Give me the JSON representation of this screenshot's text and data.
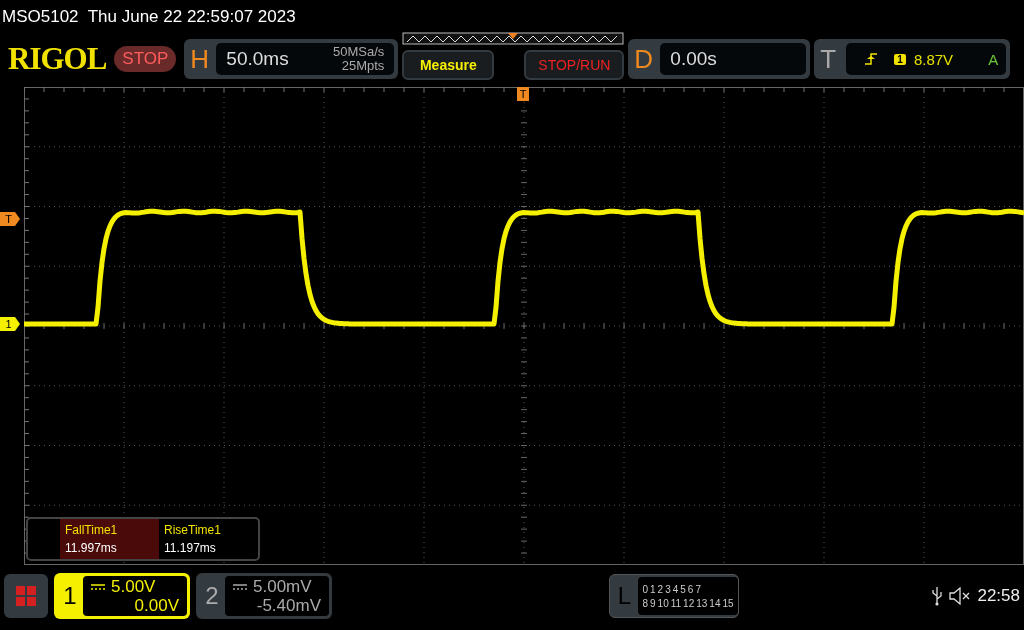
{
  "device_info": "MSO5102  Thu June 22 22:59:07 2023",
  "logo": "RIGOL",
  "run_state": {
    "label": "STOP",
    "kind": "stop"
  },
  "horizontal": {
    "letter": "H",
    "timebase": "50.0ms",
    "sample_rate": "50MSa/s",
    "memory_depth": "25Mpts"
  },
  "buttons": [
    {
      "label": "Measure",
      "kind": "measure"
    },
    {
      "label": "STOP/RUN",
      "kind": "stoprun"
    }
  ],
  "delay": {
    "letter": "D",
    "value": "0.00s"
  },
  "trigger": {
    "letter": "T",
    "source": "1",
    "level": "8.87V",
    "mode": "A"
  },
  "markers": [
    {
      "label": "T",
      "kind": "trigger-position"
    },
    {
      "label": "T",
      "kind": "trigger-level"
    },
    {
      "label": "1",
      "kind": "channel"
    }
  ],
  "measurements": [
    {
      "name": "FallTime1",
      "value": "11.997ms",
      "selected": true
    },
    {
      "name": "RiseTime1",
      "value": "11.197ms",
      "selected": false
    }
  ],
  "channels": [
    {
      "number": "1",
      "scale": "5.00V",
      "offset": "0.00V",
      "selected": true
    },
    {
      "number": "2",
      "scale": "5.00mV",
      "offset": "-5.40mV",
      "selected": false
    }
  ],
  "logic": {
    "letter": "L",
    "row_1": [
      "0",
      "1",
      "2",
      "3",
      "4",
      "5",
      "6",
      "7"
    ],
    "row_2": [
      "8",
      "9",
      "10",
      "11",
      "12",
      "13",
      "14",
      "15"
    ]
  },
  "status": {
    "time": "22:58",
    "muted": true
  }
}
